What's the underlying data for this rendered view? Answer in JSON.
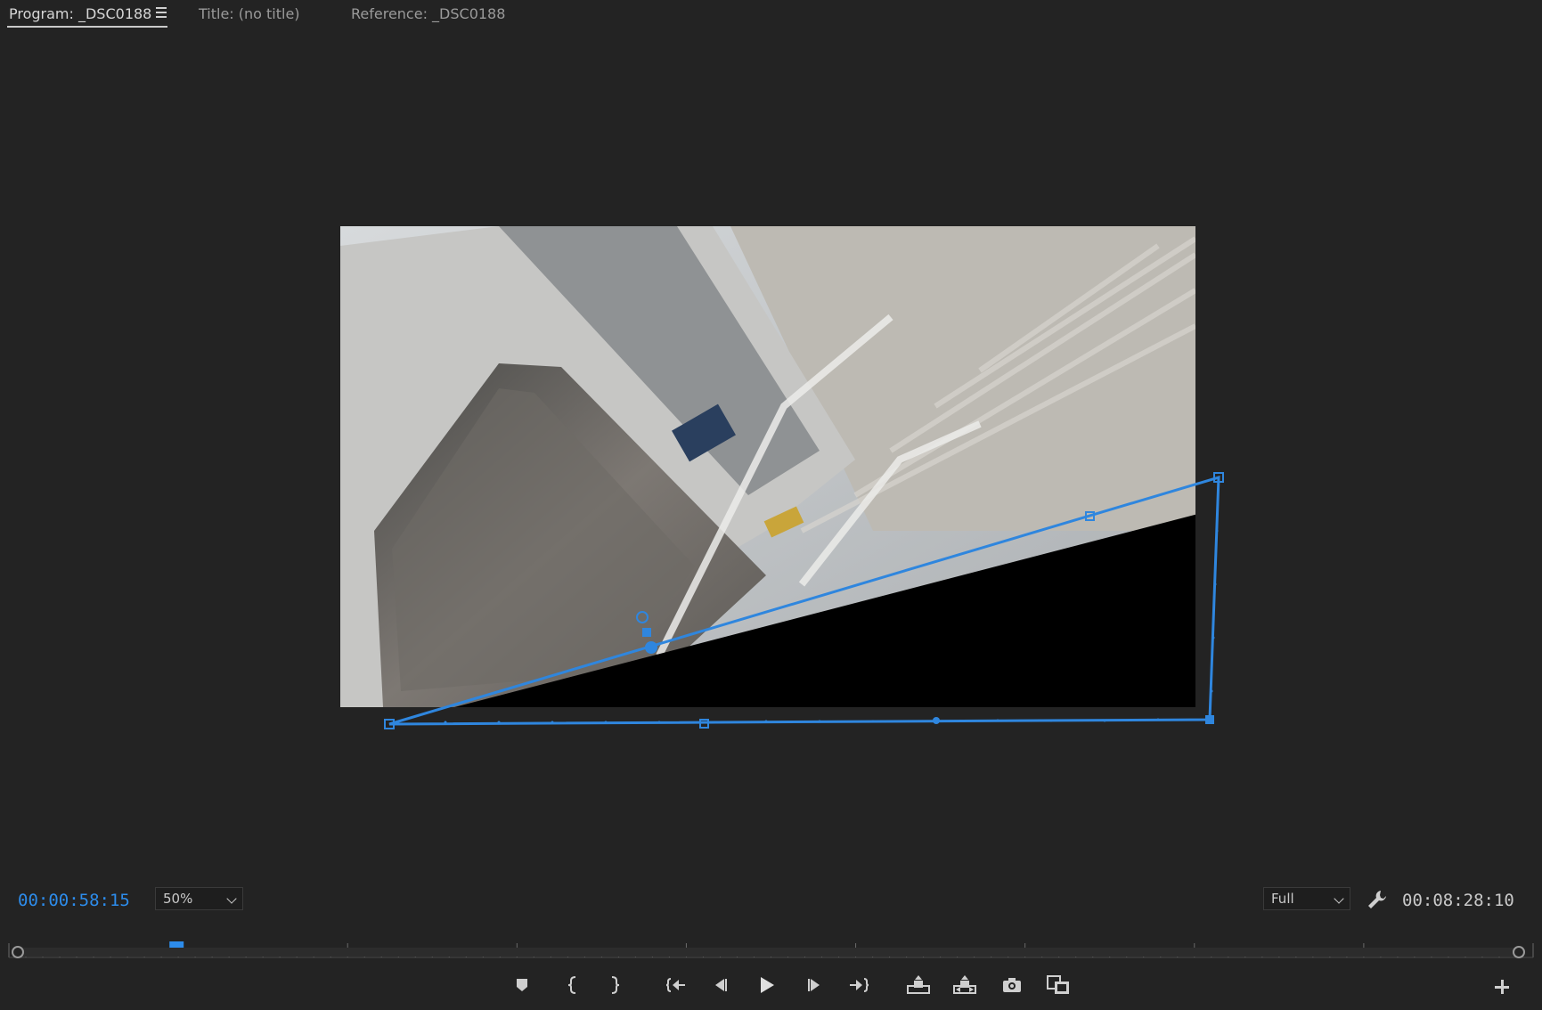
{
  "tabs": [
    {
      "label": "Program: _DSC0188",
      "active": true
    },
    {
      "label": "Title: (no title)",
      "active": false
    },
    {
      "label": "Reference: _DSC0188",
      "active": false
    }
  ],
  "viewer": {
    "timecode_current": "00:00:58:15",
    "timecode_duration": "00:08:28:10",
    "zoom_level": "50%",
    "playback_resolution": "Full"
  },
  "timeline": {
    "playhead_fraction": 0.11
  },
  "transport_buttons": [
    {
      "name": "add-marker-icon",
      "label": "Add Marker"
    },
    {
      "name": "mark-in-icon",
      "label": "Mark In"
    },
    {
      "name": "mark-out-icon",
      "label": "Mark Out"
    },
    {
      "name": "go-to-in-icon",
      "label": "Go to In"
    },
    {
      "name": "step-back-icon",
      "label": "Step Back 1 Frame"
    },
    {
      "name": "play-icon",
      "label": "Play-Stop Toggle"
    },
    {
      "name": "step-forward-icon",
      "label": "Step Forward 1 Frame"
    },
    {
      "name": "go-to-out-icon",
      "label": "Go to Out"
    },
    {
      "name": "lift-icon",
      "label": "Lift"
    },
    {
      "name": "extract-icon",
      "label": "Extract"
    },
    {
      "name": "export-frame-icon",
      "label": "Export Frame"
    },
    {
      "name": "comparison-view-icon",
      "label": "Comparison View"
    }
  ],
  "colors": {
    "accent": "#2d8ceb",
    "background": "#232323",
    "mask": "#2f86de"
  }
}
